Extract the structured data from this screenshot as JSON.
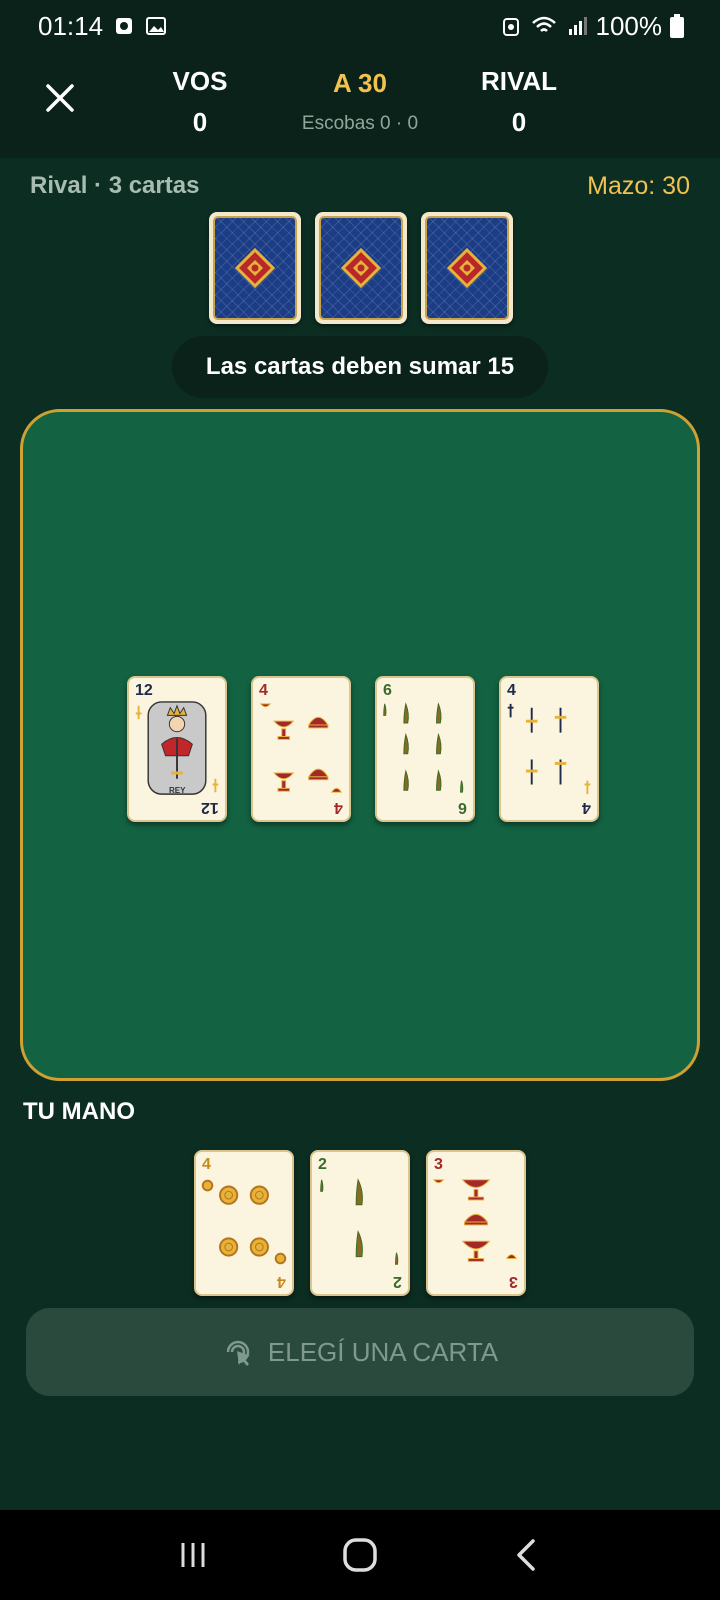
{
  "status_bar": {
    "time": "01:14",
    "battery": "100%"
  },
  "header": {
    "vos_label": "VOS",
    "vos_score": "0",
    "target": "A 30",
    "escobas": "Escobas 0 · 0",
    "rival_label": "RIVAL",
    "rival_score": "0"
  },
  "rival": {
    "label": "Rival · 3 cartas",
    "mazo": "Mazo: 30"
  },
  "hint": "Las cartas deben sumar 15",
  "table_cards": [
    {
      "rank": "12",
      "suit": "espada",
      "figure": "REY"
    },
    {
      "rank": "4",
      "suit": "copa"
    },
    {
      "rank": "6",
      "suit": "basto"
    },
    {
      "rank": "4",
      "suit": "espada"
    }
  ],
  "hand": {
    "title": "TU MANO",
    "cards": [
      {
        "rank": "4",
        "suit": "oro"
      },
      {
        "rank": "2",
        "suit": "basto"
      },
      {
        "rank": "3",
        "suit": "copa"
      }
    ]
  },
  "action_button": {
    "label": "ELEGÍ UNA CARTA"
  },
  "colors": {
    "accent_gold": "#f2c14e",
    "felt": "#136343",
    "table_border": "#cfa032"
  }
}
